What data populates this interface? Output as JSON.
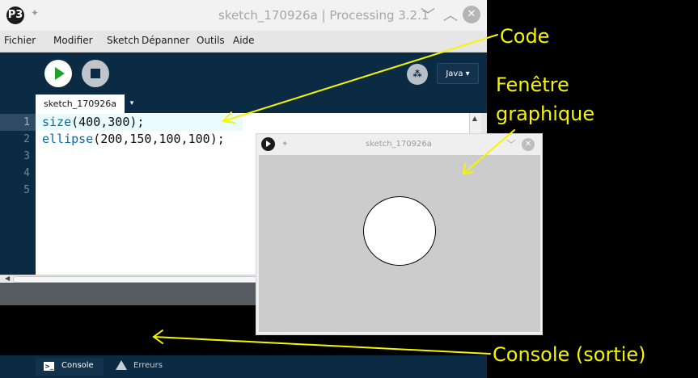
{
  "ide": {
    "window_title": "sketch_170926a | Processing 3.2.1",
    "logo_text": "P3",
    "menu": [
      "Fichier",
      "Modifier",
      "Sketch",
      "Dépanner",
      "Outils",
      "Aide"
    ],
    "mode_label": "Java ▾",
    "tab_label": "sketch_170926a",
    "tab_menu_icon": "▾",
    "line_numbers": [
      "1",
      "2",
      "3",
      "4",
      "5"
    ],
    "code": [
      {
        "fn": "size",
        "args": "(400,300);"
      },
      {
        "fn": "ellipse",
        "args": "(200,150,100,100);"
      }
    ],
    "console_tab": "Console",
    "errors_tab": "Erreurs"
  },
  "graphic_window": {
    "title": "sketch_170926a"
  },
  "annotations": {
    "code": "Code",
    "graphic_line1": "Fenêtre",
    "graphic_line2": "graphique",
    "console": "Console (sortie)"
  },
  "colors": {
    "annotation": "#f5f500",
    "toolbar": "#0b2a44",
    "run": "#1fa12a"
  }
}
